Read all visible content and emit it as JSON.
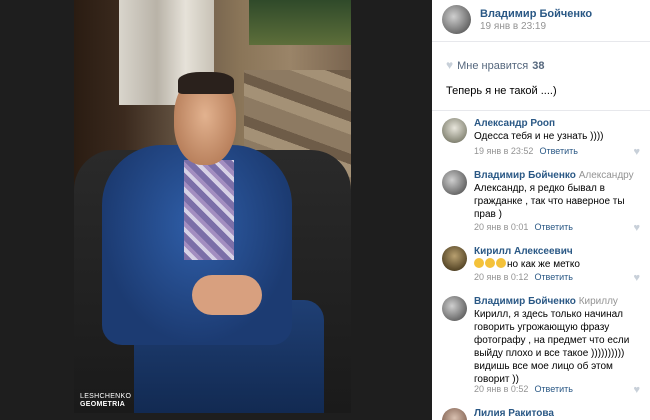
{
  "watermark": {
    "line1": "LESHCHENKO",
    "line2": "GEOMETRIA"
  },
  "post": {
    "author": "Владимир Бойченко",
    "date": "19 янв в 23:19",
    "likes_label": "Мне нравится",
    "likes_count": "38",
    "text": "Теперь я не такой ....)"
  },
  "comments": [
    {
      "author": "Александр Рооп",
      "reply_to": "",
      "text": "Одесса тебя и не узнать ))))",
      "date": "19 янв в 23:52",
      "reply_label": "Ответить"
    },
    {
      "author": "Владимир Бойченко",
      "reply_to": "Александру",
      "text": "Александр, я редко бывал в гражданке , так что наверное ты прав )",
      "date": "20 янв в 0:01",
      "reply_label": "Ответить"
    },
    {
      "author": "Кирилл Алексеевич",
      "reply_to": "",
      "text": "но как же метко",
      "date": "20 янв в 0:12",
      "reply_label": "Ответить"
    },
    {
      "author": "Владимир Бойченко",
      "reply_to": "Кириллу",
      "text": "Кирилл, я здесь только начинал говорить угрожающую фразу фотографу , на предмет что если выйду плохо и все такое )))))))))) видишь все мое лицо об этом говорит ))",
      "date": "20 янв в 0:52",
      "reply_label": "Ответить"
    },
    {
      "author": "Лилия Ракитова",
      "reply_to": "",
      "text": "",
      "date": "",
      "reply_label": ""
    }
  ],
  "colors": {
    "link": "#2a5885",
    "muted": "#939393",
    "background": "#000000"
  }
}
